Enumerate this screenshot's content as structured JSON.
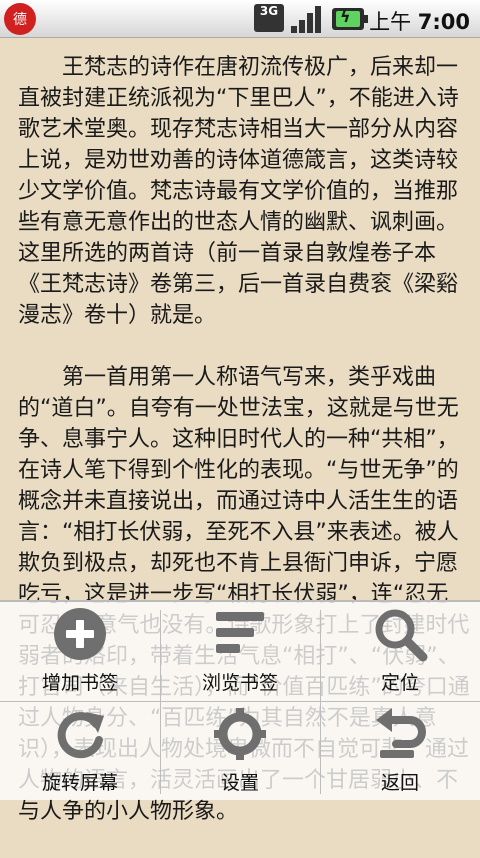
{
  "status_bar": {
    "app_icon_text": "德",
    "network": "3G",
    "clock_prefix": "上午",
    "clock_time": "7:00"
  },
  "content": {
    "paragraphs": [
      "王梵志的诗作在唐初流传极广，后来却一直被封建正统派视为“下里巴人”，不能进入诗歌艺术堂奥。现存梵志诗相当大一部分从内容上说，是劝世劝善的诗体道德箴言，这类诗较少文学价值。梵志诗最有文学价值的，当推那些有意无意作出的世态人情的幽默、讽刺画。这里所选的两首诗（前一首录自敦煌卷子本《王梵志诗》卷第三，后一首录自费衮《梁谿漫志》卷十）就是。",
      "第一首用第一人称语气写来，类乎戏曲的“道白”。自夸有一处世法宝，这就是与世无争、息事宁人。这种旧时代人的一种“共相”，在诗人笔下得到个性化的表现。“与世无争”的概念并未直接说出，而通过诗中人活生生的语言：“相打长伏弱，至死不入县”来表述。被人欺负到极点，却死也不肯上县衙门申诉，宁愿吃亏，这是进一步写“相打长伏弱”，连“忍无可忍”的意气也没有。诗歌形象打上了封建时代弱者的烙印，带着生活气息“相打”、“伏弱”、打官司（来自生活），而“价值百匹练”的夸口通过人物身分、“百匹练”为其自然不是真人意识），表现出人物处境卑微而不自觉可悲。通过人物的语言，活灵活画出了一个甘居弱小、不与人争的小人物形象。"
    ]
  },
  "menu": {
    "items": [
      {
        "label": "增加书签",
        "icon": "add-bookmark-icon"
      },
      {
        "label": "浏览书签",
        "icon": "browse-bookmarks-icon"
      },
      {
        "label": "定位",
        "icon": "search-locate-icon"
      },
      {
        "label": "旋转屏幕",
        "icon": "rotate-screen-icon"
      },
      {
        "label": "设置",
        "icon": "settings-gear-icon"
      },
      {
        "label": "返回",
        "icon": "back-arrow-icon"
      }
    ]
  },
  "colors": {
    "page_background": "#e9dcc3",
    "text": "#1a1a1a",
    "icon_gray": "#6f6f6f",
    "battery_green": "#5fd35f",
    "app_icon_red": "#d02020"
  }
}
